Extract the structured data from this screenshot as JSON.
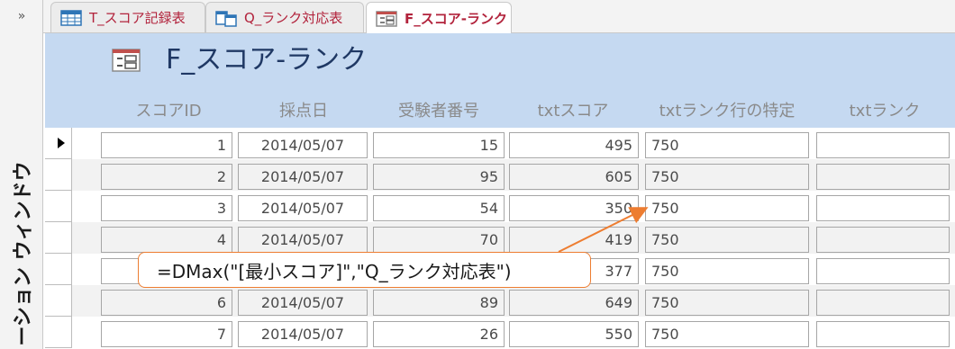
{
  "nav": {
    "toggle_glyph": "»",
    "pane_label": "ーション ウィンドウ"
  },
  "tabs": [
    {
      "label": "T_スコア記録表",
      "icon": "table-icon"
    },
    {
      "label": "Q_ランク対応表",
      "icon": "query-icon"
    },
    {
      "label": "F_スコア-ランク",
      "icon": "form-icon",
      "active": true
    }
  ],
  "form": {
    "title": "F_スコア-ランク",
    "columns": [
      "スコアID",
      "採点日",
      "受験者番号",
      "txtスコア",
      "txtランク行の特定",
      "txtランク"
    ]
  },
  "rows": [
    {
      "id": "1",
      "date": "2014/05/07",
      "examinee": "15",
      "score": "495",
      "rank_row": "750",
      "rank": ""
    },
    {
      "id": "2",
      "date": "2014/05/07",
      "examinee": "95",
      "score": "605",
      "rank_row": "750",
      "rank": ""
    },
    {
      "id": "3",
      "date": "2014/05/07",
      "examinee": "54",
      "score": "350",
      "rank_row": "750",
      "rank": ""
    },
    {
      "id": "4",
      "date": "2014/05/07",
      "examinee": "70",
      "score": "419",
      "rank_row": "750",
      "rank": ""
    },
    {
      "id": "",
      "date": "",
      "examinee": "",
      "score": "377",
      "rank_row": "750",
      "rank": ""
    },
    {
      "id": "6",
      "date": "2014/05/07",
      "examinee": "89",
      "score": "649",
      "rank_row": "750",
      "rank": ""
    },
    {
      "id": "7",
      "date": "2014/05/07",
      "examinee": "26",
      "score": "550",
      "rank_row": "750",
      "rank": ""
    }
  ],
  "callout": {
    "text": "=DMax(\"[最小スコア]\",\"Q_ランク対応表\")"
  },
  "colors": {
    "header_bg": "#c5d9f1",
    "title": "#1f3864",
    "tab_text": "#b2233c",
    "callout_border": "#ed7d31",
    "alt_row": "#f2f2f2"
  }
}
